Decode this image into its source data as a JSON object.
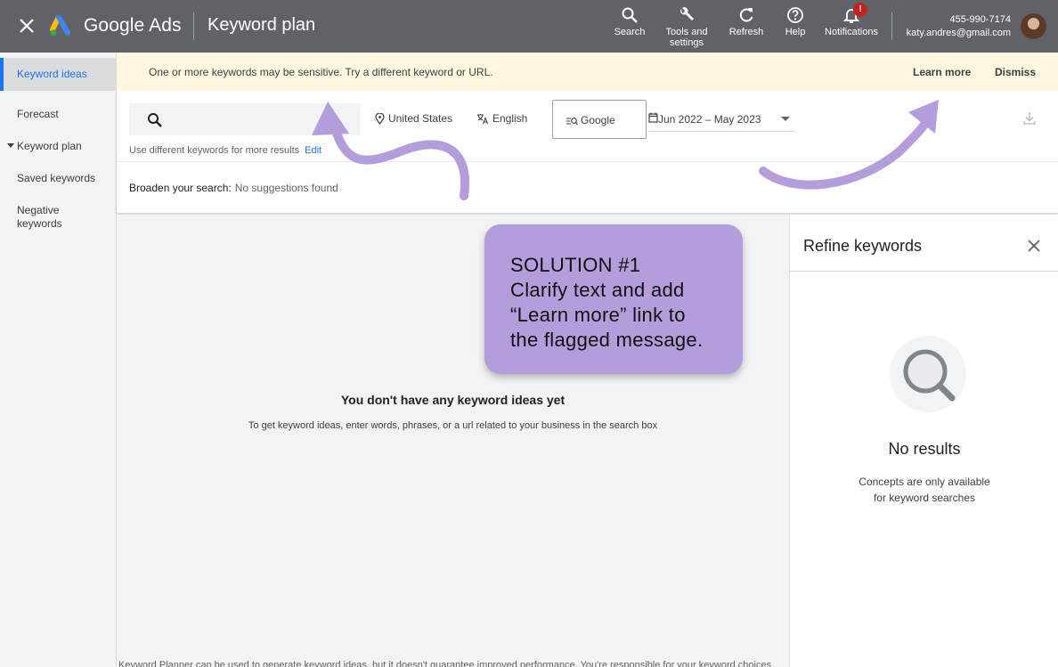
{
  "header": {
    "brand": "Google Ads",
    "page_title": "Keyword plan",
    "tools": [
      {
        "label": "Search",
        "icon": "search-icon"
      },
      {
        "label": "Tools and settings",
        "icon": "wrench-icon"
      },
      {
        "label": "Refresh",
        "icon": "refresh-icon"
      },
      {
        "label": "Help",
        "icon": "help-icon"
      },
      {
        "label": "Notifications",
        "icon": "bell-icon"
      }
    ],
    "notification_badge": "!",
    "account_phone": "455-990-7174",
    "account_email": "katy.andres@gmail.com"
  },
  "sidebar": {
    "items": [
      {
        "label": "Keyword ideas",
        "active": true
      },
      {
        "label": "Forecast"
      },
      {
        "label": "Keyword plan"
      },
      {
        "label": "Saved keywords"
      },
      {
        "label": "Negative keywords"
      }
    ]
  },
  "banner": {
    "message": "One or more keywords may be sensitive. Try a different keyword or URL.",
    "learn_more": "Learn more",
    "dismiss": "Dismiss"
  },
  "search": {
    "location": "United States",
    "language": "English",
    "network": "Google",
    "date_range": "Jun 2022 – May 2023",
    "hint": "Use different keywords for more results",
    "edit": "Edit",
    "broaden_label": "Broaden your search:",
    "broaden_value": "No suggestions found"
  },
  "main": {
    "empty_title": "You don't have any keyword ideas yet",
    "empty_sub": "To get keyword ideas, enter words, phrases, or a url related to your business in the search box",
    "disclaimer": "Keyword Planner can be used to generate keyword ideas, but it doesn't guarantee improved performance. You're responsible for your keyword choices"
  },
  "refine": {
    "title": "Refine keywords",
    "no_results": "No results",
    "concepts_line1": "Concepts are only available",
    "concepts_line2": "for keyword searches"
  },
  "annotation": {
    "line1": "SOLUTION #1",
    "line2": "Clarify text and add",
    "line3": "“Learn more” link to",
    "line4": "the flagged message."
  },
  "colors": {
    "header_bg": "#5f6368",
    "banner_bg": "#fef7e0",
    "accent": "#1a73e8",
    "annotation_purple": "#b39ddb"
  }
}
